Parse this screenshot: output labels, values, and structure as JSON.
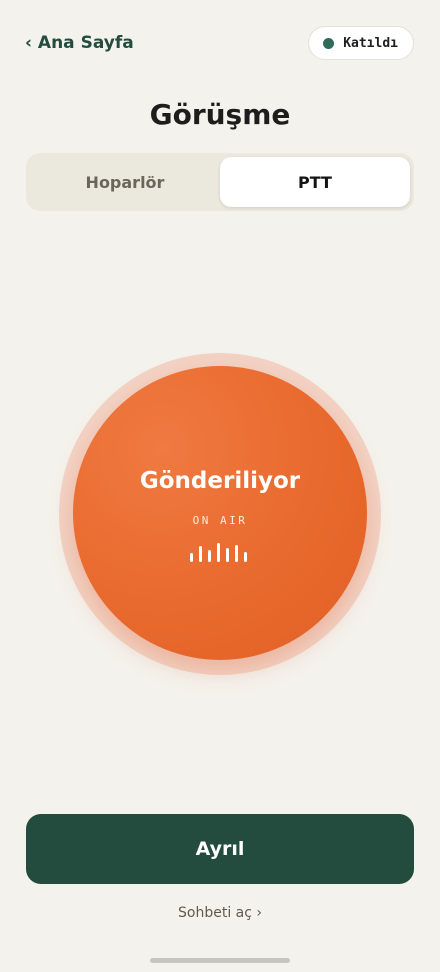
{
  "header": {
    "back_label": "‹ Ana Sayfa",
    "status": {
      "text": "Katıldı",
      "dot_color": "#2f6b58"
    }
  },
  "title": "Görüşme",
  "mode_tabs": [
    {
      "label": "Hoparlör",
      "active": false
    },
    {
      "label": "PTT",
      "active": true
    }
  ],
  "ptt": {
    "label": "Gönderiliyor",
    "sublabel": "ON AIR",
    "color": "#e8672c",
    "level_bars": [
      0.45,
      0.8,
      0.6,
      0.95,
      0.7,
      0.85,
      0.5
    ]
  },
  "leave_label": "Ayrıl",
  "chat_link": "Sohbeti aç ›"
}
